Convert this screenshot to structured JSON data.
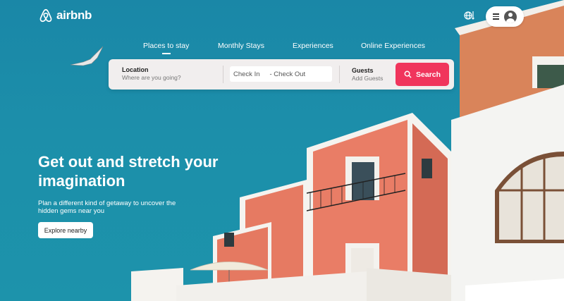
{
  "brand": {
    "name": "airbnb"
  },
  "header": {
    "globe_icon": "globe-icon",
    "menu_icon": "hamburger-icon",
    "avatar_icon": "user-avatar-icon"
  },
  "nav": {
    "items": [
      {
        "label": "Places to stay",
        "active": true
      },
      {
        "label": "Monthly Stays",
        "active": false
      },
      {
        "label": "Experiences",
        "active": false
      },
      {
        "label": "Online Experiences",
        "active": false
      }
    ]
  },
  "search": {
    "location_label": "Location",
    "location_placeholder": "Where are you going?",
    "checkin": "Check In",
    "checkout": "- Check Out",
    "guests_label": "Guests",
    "guests_placeholder": "Add Guests",
    "button_label": "Search",
    "button_color": "#f0355c"
  },
  "hero": {
    "headline": "Get out and stretch your imagination",
    "subline": "Plan a different kind of getaway to uncover the hidden gems near you",
    "cta": "Explore nearby"
  },
  "colors": {
    "sky": "#1b8aa6",
    "accent": "#f0355c"
  }
}
